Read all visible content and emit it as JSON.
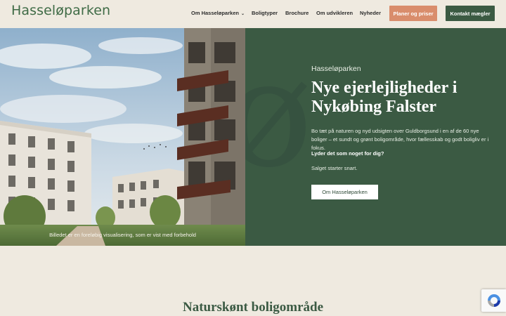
{
  "header": {
    "logo": "Hasseløparken",
    "nav": {
      "about": "Om Hasseløparken",
      "types": "Boligtyper",
      "brochure": "Brochure",
      "developer": "Om udvikleren",
      "news": "Nyheder"
    },
    "plans_button": "Planer og priser",
    "contact_button": "Kontakt mægler"
  },
  "hero": {
    "caption": "Billedet er en foreløbig visualisering, som er vist med forbehold",
    "decorative_letter": "ø",
    "eyebrow": "Hasseløparken",
    "title": "Nye ejerlejligheder i Nykøbing Falster",
    "body": "Bo tæt på naturen og nyd udsigten over Guldborgsund i en af de 60 nye boliger – et sundt og grønt boligområde, hvor fællesskab og godt boligliv er i fokus.",
    "question": "Lyder det som noget for dig?",
    "sale": "Salget starter snart.",
    "button": "Om Hasseløparken"
  },
  "section": {
    "title": "Naturskønt boligområde"
  },
  "colors": {
    "brand_green": "#3b5a43",
    "accent_orange": "#d98d6c",
    "background": "#efeae0"
  }
}
